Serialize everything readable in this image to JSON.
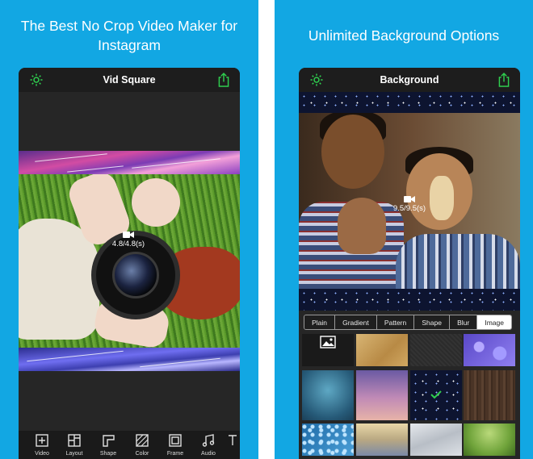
{
  "left": {
    "promo_text": "The Best No Crop Video Maker for Instagram",
    "app_title": "Vid Square",
    "clip_duration": "4.8/4.8(s)",
    "toolbar": [
      {
        "label": "Video",
        "icon": "add-square-icon"
      },
      {
        "label": "Layout",
        "icon": "layout-grid-icon"
      },
      {
        "label": "Shape",
        "icon": "shape-corner-icon"
      },
      {
        "label": "Color",
        "icon": "hatched-square-icon"
      },
      {
        "label": "Frame",
        "icon": "frame-icon"
      },
      {
        "label": "Audio",
        "icon": "music-note-icon"
      }
    ]
  },
  "right": {
    "promo_text": "Unlimited Background Options",
    "app_title": "Background",
    "clip_duration": "9.5/9.5(s)",
    "tabs": [
      {
        "label": "Plain",
        "active": false
      },
      {
        "label": "Gradient",
        "active": false
      },
      {
        "label": "Pattern",
        "active": false
      },
      {
        "label": "Shape",
        "active": false
      },
      {
        "label": "Blur",
        "active": false
      },
      {
        "label": "Image",
        "active": true
      }
    ],
    "backgrounds": [
      {
        "name": "add-photo",
        "color": "#1a1a1a"
      },
      {
        "name": "parchment",
        "color": "#c9a25f"
      },
      {
        "name": "dark-leather",
        "color": "#2a2a2a"
      },
      {
        "name": "purple-bokeh",
        "color": "#6b5bd6"
      },
      {
        "name": "teal-glow",
        "color": "#2d6f8e"
      },
      {
        "name": "pink-sunset",
        "color": "#c48ab5"
      },
      {
        "name": "starfield",
        "color": "#0d1430",
        "selected": true
      },
      {
        "name": "brown-wood",
        "color": "#4a3426"
      },
      {
        "name": "blue-sparkles",
        "color": "#2f87c5"
      },
      {
        "name": "warm-horizon",
        "color": "#c8b48a"
      },
      {
        "name": "white-cloth",
        "color": "#c7ccd2"
      },
      {
        "name": "green-meadow",
        "color": "#6fa33a"
      }
    ]
  },
  "colors": {
    "panel_bg": "#12a7e3",
    "phone_bg": "#262626",
    "accent_green": "#2fcf4f"
  }
}
